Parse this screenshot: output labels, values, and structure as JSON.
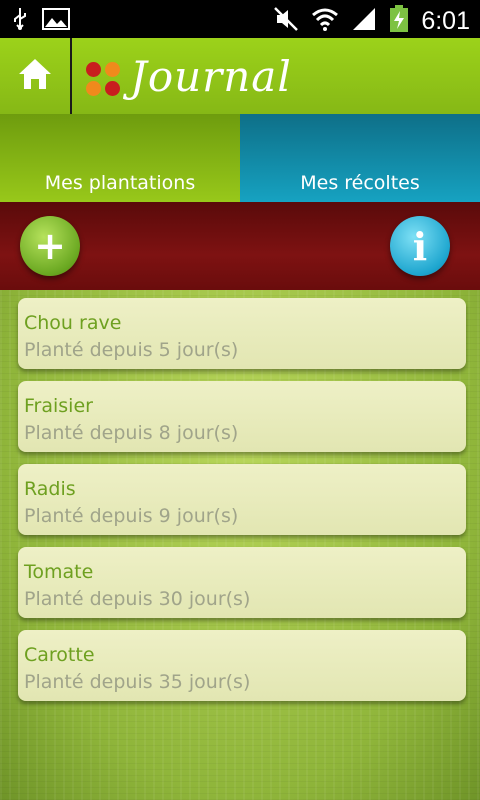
{
  "status_bar": {
    "time": "6:01",
    "icons": [
      "usb-icon",
      "image-icon",
      "mute-icon",
      "wifi-icon",
      "signal-icon",
      "battery-charging-icon"
    ]
  },
  "header": {
    "title": "Journal",
    "colors": {
      "bar": "#9cd21a",
      "dot_red": "#c81e1e",
      "dot_orange": "#f08a1c"
    }
  },
  "tabs": [
    {
      "label": "Mes plantations",
      "active": true
    },
    {
      "label": "Mes récoltes",
      "active": false
    }
  ],
  "actions": {
    "add_symbol": "+",
    "info_symbol": "i"
  },
  "plantations": [
    {
      "name": "Chou rave",
      "detail": "Planté depuis 5 jour(s)"
    },
    {
      "name": "Fraisier",
      "detail": "Planté depuis 8 jour(s)"
    },
    {
      "name": "Radis",
      "detail": "Planté depuis 9 jour(s)"
    },
    {
      "name": "Tomate",
      "detail": "Planté depuis 30 jour(s)"
    },
    {
      "name": "Carotte",
      "detail": "Planté depuis 35 jour(s)"
    }
  ]
}
